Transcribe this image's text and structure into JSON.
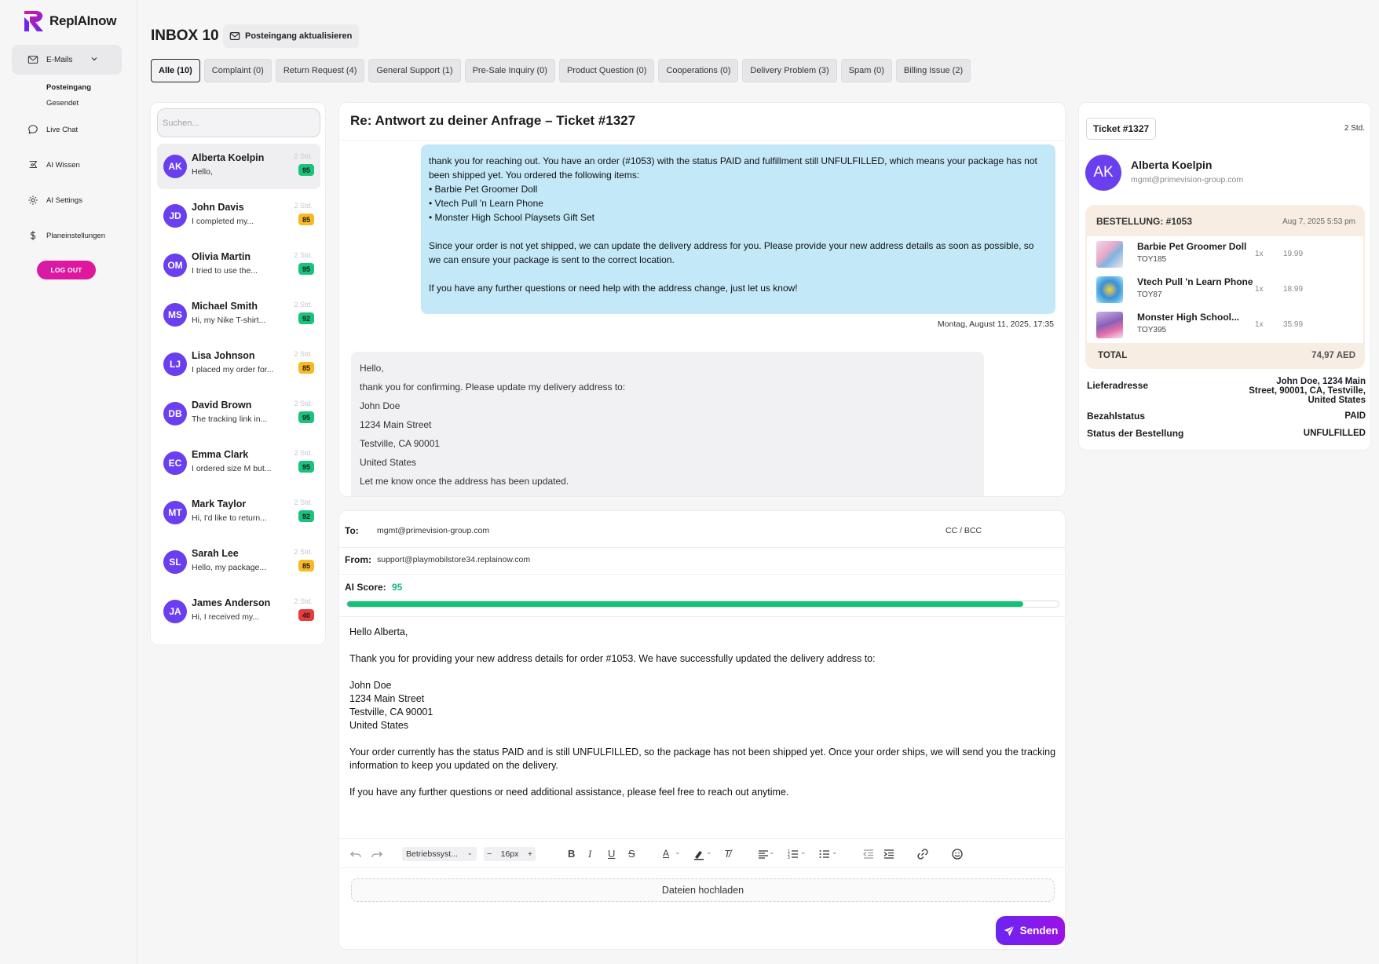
{
  "app": {
    "name": "ReplAInow"
  },
  "sidebar": {
    "emails_label": "E-Mails",
    "sub_items": [
      {
        "label": "Posteingang",
        "active": true
      },
      {
        "label": "Gesendet",
        "active": false
      }
    ],
    "items": [
      {
        "label": "Live Chat",
        "icon": "chat-icon"
      },
      {
        "label": "AI Wissen",
        "icon": "knowledge-icon"
      },
      {
        "label": "AI Settings",
        "icon": "gear-icon"
      },
      {
        "label": "Planeinstellungen",
        "icon": "dollar-icon"
      }
    ],
    "logout_label": "LOG OUT"
  },
  "header": {
    "title": "INBOX 10",
    "refresh_label": "Posteingang aktualisieren"
  },
  "tabs": [
    {
      "label": "Alle (10)",
      "active": true
    },
    {
      "label": "Complaint (0)"
    },
    {
      "label": "Return Request (4)"
    },
    {
      "label": "General Support (1)"
    },
    {
      "label": "Pre-Sale Inquiry (0)"
    },
    {
      "label": "Product Question (0)"
    },
    {
      "label": "Cooperations (0)"
    },
    {
      "label": "Delivery Problem (3)"
    },
    {
      "label": "Spam (0)"
    },
    {
      "label": "Billing Issue (2)"
    }
  ],
  "search": {
    "placeholder": "Suchen..."
  },
  "conversations": [
    {
      "initials": "AK",
      "name": "Alberta Koelpin",
      "preview": "Hello,",
      "time": "2 Std.",
      "score": "95",
      "color": "#19c37d",
      "active": true
    },
    {
      "initials": "JD",
      "name": "John Davis",
      "preview": "I completed my...",
      "time": "2 Std.",
      "score": "85",
      "color": "#f7b924"
    },
    {
      "initials": "OM",
      "name": "Olivia Martin",
      "preview": "I tried to use the...",
      "time": "2 Std.",
      "score": "95",
      "color": "#19c37d"
    },
    {
      "initials": "MS",
      "name": "Michael Smith",
      "preview": "Hi, my Nike T-shirt...",
      "time": "2 Std.",
      "score": "92",
      "color": "#19c37d"
    },
    {
      "initials": "LJ",
      "name": "Lisa Johnson",
      "preview": "I placed my order for...",
      "time": "2 Std.",
      "score": "85",
      "color": "#f7b924"
    },
    {
      "initials": "DB",
      "name": "David Brown",
      "preview": "The tracking link in...",
      "time": "2 Std.",
      "score": "95",
      "color": "#19c37d"
    },
    {
      "initials": "EC",
      "name": "Emma Clark",
      "preview": "I ordered size M but...",
      "time": "2 Std.",
      "score": "95",
      "color": "#19c37d"
    },
    {
      "initials": "MT",
      "name": "Mark Taylor",
      "preview": "Hi, I'd like to return...",
      "time": "2 Std.",
      "score": "92",
      "color": "#19c37d"
    },
    {
      "initials": "SL",
      "name": "Sarah Lee",
      "preview": "Hello, my package...",
      "time": "2 Std.",
      "score": "85",
      "color": "#f7b924"
    },
    {
      "initials": "JA",
      "name": "James Anderson",
      "preview": "Hi, I received my...",
      "time": "2 Std.",
      "score": "40",
      "color": "#ea3a3a"
    }
  ],
  "thread": {
    "subject": "Re: Antwort zu deiner Anfrage – Ticket #1327",
    "outgoing": {
      "lines": [
        "thank you for reaching out. You have an order (#1053) with the status PAID and fulfillment still UNFULFILLED, which means your package has not been shipped yet. You ordered the following items:",
        "• Barbie Pet Groomer Doll",
        "• Vtech Pull 'n Learn Phone",
        "• Monster High School Playsets Gift Set"
      ],
      "para2": "Since your order is not yet shipped, we can update the delivery address for you. Please provide your new address details as soon as possible, so we can ensure your package is sent to the correct location.",
      "para3": "If you have any further questions or need help with the address change, just let us know!",
      "date": "Montag, August 11, 2025, 17:35"
    },
    "incoming": [
      "Hello,",
      "thank you for confirming. Please update my delivery address to:",
      "John Doe",
      "1234 Main Street",
      "Testville, CA 90001",
      "United States",
      "Let me know once the address has been updated."
    ]
  },
  "compose": {
    "to_label": "To:",
    "to_value": "mgmt@primevision-group.com",
    "cc_label": "CC / BCC",
    "from_label": "From:",
    "from_value": "support@playmobilstore34.replainow.com",
    "ai_score_label": "AI Score:",
    "ai_score": "95",
    "ai_score_fraction": 0.95,
    "body": {
      "greeting": "Hello Alberta,",
      "p1": "Thank you for providing your new address details for order #1053. We have successfully updated the delivery address to:",
      "address": [
        "John Doe",
        "1234 Main Street",
        "Testville, CA 90001",
        "United States"
      ],
      "p2": "Your order currently has the status PAID and is still UNFULFILLED, so the package has not been shipped yet. Once your order ships, we will send you the tracking information to keep you updated on the delivery.",
      "p3": "If you have any further questions or need additional assistance, please feel free to reach out anytime."
    },
    "font_family_value": "Betriebssyst...",
    "font_size_value": "16px",
    "upload_label": "Dateien hochladen",
    "send_label": "Senden"
  },
  "ticket": {
    "chip": "Ticket #1327",
    "time": "2 Std.",
    "initials": "AK",
    "name": "Alberta Koelpin",
    "email": "mgmt@primevision-group.com",
    "order": {
      "title": "BESTELLUNG: #1053",
      "date": "Aug 7, 2025 5:53 pm",
      "items": [
        {
          "name": "Barbie Pet Groomer Doll",
          "sku": "TOY185",
          "qty": "1x",
          "price": "19.99"
        },
        {
          "name": "Vtech Pull 'n Learn Phone",
          "sku": "TOY87",
          "qty": "1x",
          "price": "18.99"
        },
        {
          "name": "Monster High School...",
          "sku": "TOY395",
          "qty": "1x",
          "price": "35.99"
        }
      ],
      "total_label": "TOTAL",
      "total_value": "74,97 AED"
    },
    "details": [
      {
        "label": "Lieferadresse",
        "value": "John Doe, 1234 Main Street, 90001, CA, Testville, United States"
      },
      {
        "label": "Bezahlstatus",
        "value": "PAID"
      },
      {
        "label": "Status der Bestellung",
        "value": "UNFULFILLED"
      }
    ]
  },
  "colors": {
    "accent": "#6a3ff0",
    "ai_bar": "#17c07a",
    "outgoing_bubble": "#c3e9f9",
    "logout": "#d81aa7"
  }
}
